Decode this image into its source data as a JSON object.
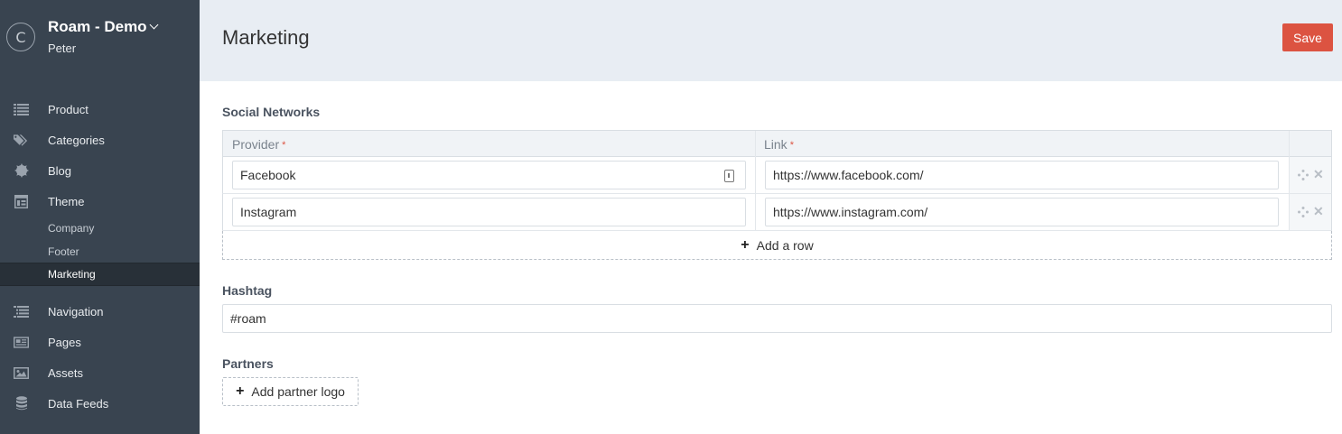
{
  "sidebar": {
    "brand_initial": "C",
    "brand_title": "Roam - Demo",
    "brand_user": "Peter",
    "items": [
      {
        "label": "Product",
        "icon": "list-icon"
      },
      {
        "label": "Categories",
        "icon": "tags-icon"
      },
      {
        "label": "Blog",
        "icon": "badge-icon"
      },
      {
        "label": "Theme",
        "icon": "layout-icon"
      },
      {
        "label": "Navigation",
        "icon": "indented-list-icon"
      },
      {
        "label": "Pages",
        "icon": "newspaper-icon"
      },
      {
        "label": "Assets",
        "icon": "image-icon"
      },
      {
        "label": "Data Feeds",
        "icon": "database-icon"
      }
    ],
    "theme_subitems": [
      {
        "label": "Company"
      },
      {
        "label": "Footer"
      },
      {
        "label": "Marketing",
        "active": true
      }
    ]
  },
  "header": {
    "title": "Marketing",
    "save_label": "Save"
  },
  "social": {
    "section_label": "Social Networks",
    "columns": [
      "Provider",
      "Link"
    ],
    "required_mark": "*",
    "rows": [
      {
        "provider": "Facebook",
        "link": "https://www.facebook.com/"
      },
      {
        "provider": "Instagram",
        "link": "https://www.instagram.com/"
      }
    ],
    "add_row_label": "Add a row"
  },
  "hashtag": {
    "section_label": "Hashtag",
    "value": "#roam"
  },
  "partners": {
    "section_label": "Partners",
    "add_label": "Add partner logo"
  },
  "colors": {
    "sidebar_bg": "#394450",
    "header_bg": "#e8edf3",
    "accent": "#dc5341"
  }
}
